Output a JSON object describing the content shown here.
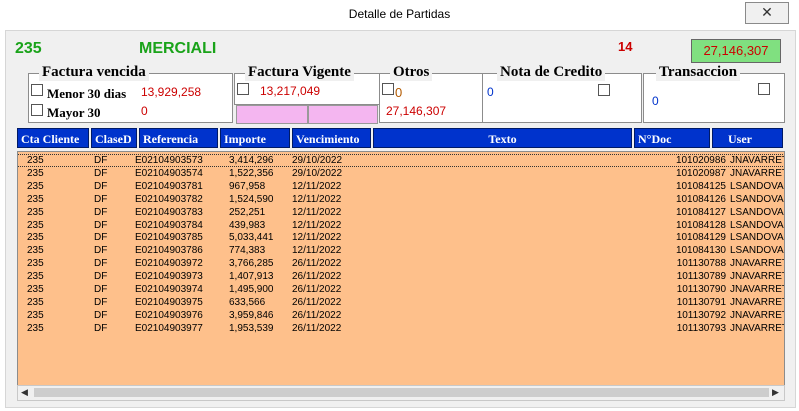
{
  "window": {
    "title": "Detalle de Partidas",
    "close_icon": "✕"
  },
  "header": {
    "code": "235",
    "name": "MERCIALI",
    "count": "14",
    "total": "27,146,307"
  },
  "groups": {
    "vencida": {
      "title": "Factura vencida",
      "menor_label": "Menor 30 dias",
      "menor_value": "13,929,258",
      "mayor_label": "Mayor 30",
      "mayor_value": "0"
    },
    "vigente": {
      "title": "Factura Vigente",
      "value": "13,217,049"
    },
    "otros": {
      "title": "Otros",
      "value": "0",
      "total": "27,146,307"
    },
    "nota": {
      "title": "Nota de Credito",
      "value": "0"
    },
    "transaccion": {
      "title": "Transaccion",
      "value": "0"
    }
  },
  "table": {
    "columns": [
      "Cta Cliente",
      "ClaseD",
      "Referencia",
      "Importe",
      "Vencimiento",
      "Texto",
      "N°Doc",
      "User"
    ],
    "rows": [
      [
        "235",
        "DF",
        "E02104903573",
        "3,414,296",
        "29/10/2022",
        "",
        "101020986",
        "JNAVARRET"
      ],
      [
        "235",
        "DF",
        "E02104903574",
        "1,522,356",
        "29/10/2022",
        "",
        "101020987",
        "JNAVARRET"
      ],
      [
        "235",
        "DF",
        "E02104903781",
        "967,958",
        "12/11/2022",
        "",
        "101084125",
        "LSANDOVAI"
      ],
      [
        "235",
        "DF",
        "E02104903782",
        "1,524,590",
        "12/11/2022",
        "",
        "101084126",
        "LSANDOVAI"
      ],
      [
        "235",
        "DF",
        "E02104903783",
        "252,251",
        "12/11/2022",
        "",
        "101084127",
        "LSANDOVAI"
      ],
      [
        "235",
        "DF",
        "E02104903784",
        "439,983",
        "12/11/2022",
        "",
        "101084128",
        "LSANDOVAI"
      ],
      [
        "235",
        "DF",
        "E02104903785",
        "5,033,441",
        "12/11/2022",
        "",
        "101084129",
        "LSANDOVAI"
      ],
      [
        "235",
        "DF",
        "E02104903786",
        "774,383",
        "12/11/2022",
        "",
        "101084130",
        "LSANDOVAI"
      ],
      [
        "235",
        "DF",
        "E02104903972",
        "3,766,285",
        "26/11/2022",
        "",
        "101130788",
        "JNAVARRET"
      ],
      [
        "235",
        "DF",
        "E02104903973",
        "1,407,913",
        "26/11/2022",
        "",
        "101130789",
        "JNAVARRET"
      ],
      [
        "235",
        "DF",
        "E02104903974",
        "1,495,900",
        "26/11/2022",
        "",
        "101130790",
        "JNAVARRET"
      ],
      [
        "235",
        "DF",
        "E02104903975",
        "633,566",
        "26/11/2022",
        "",
        "101130791",
        "JNAVARRET"
      ],
      [
        "235",
        "DF",
        "E02104903976",
        "3,959,846",
        "26/11/2022",
        "",
        "101130792",
        "JNAVARRET"
      ],
      [
        "235",
        "DF",
        "E02104903977",
        "1,953,539",
        "26/11/2022",
        "",
        "101130793",
        "JNAVARRET"
      ]
    ]
  },
  "scrollbar": {
    "left_arrow": "◀",
    "right_arrow": "▶"
  }
}
